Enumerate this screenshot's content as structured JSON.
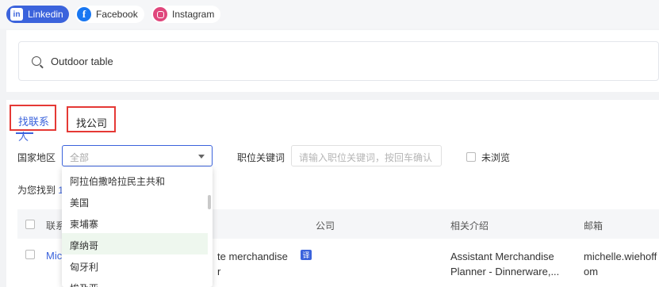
{
  "social_tabs": [
    {
      "label": "Linkedin",
      "icon": "linkedin-icon",
      "active": true
    },
    {
      "label": "Facebook",
      "icon": "facebook-icon",
      "active": false
    },
    {
      "label": "Instagram",
      "icon": "instagram-icon",
      "active": false
    }
  ],
  "search": {
    "value": "Outdoor table"
  },
  "tabs": {
    "contact": "找联系人",
    "company": "找公司"
  },
  "filters": {
    "country_label": "国家地区",
    "country_value": "全部",
    "keyword_label": "职位关键词",
    "keyword_placeholder": "请输入职位关键词，按回车确认",
    "unviewed_label": "未浏览"
  },
  "result_prefix": "为您找到",
  "result_count": "1",
  "table": {
    "headers": [
      "联系",
      "公司",
      "相关介绍",
      "邮箱"
    ],
    "rows": [
      {
        "name": "Mic",
        "role_line1": "te merchandise",
        "role_line2": "r",
        "translate_badge": "译",
        "intro_line1": "Assistant Merchandise",
        "intro_line2": "Planner - Dinnerware,...",
        "email_line1": "michelle.wiehoff",
        "email_line2": "om"
      }
    ]
  },
  "dropdown": {
    "options": [
      "阿拉伯撒哈拉民主共和",
      "美国",
      "柬埔寨",
      "摩纳哥",
      "匈牙利",
      "埃及亚"
    ],
    "highlighted_index": 3
  },
  "colors": {
    "accent": "#3b63dc",
    "highlight_border": "#e53935"
  }
}
